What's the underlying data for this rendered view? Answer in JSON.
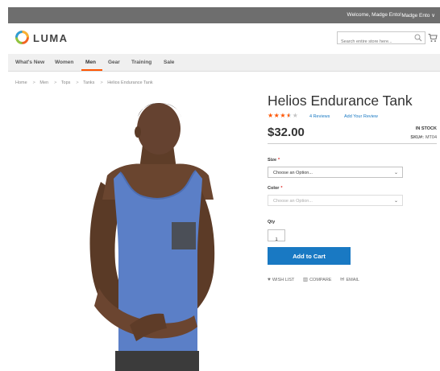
{
  "topbar": {
    "welcome": "Welcome, Madge Ento!",
    "account": "Madge Ento ∨"
  },
  "header": {
    "logo_text": "LUMA",
    "search_placeholder": "Search entire store here...",
    "icons": [
      "luma-logo-icon",
      "search-icon",
      "cart-icon"
    ]
  },
  "nav": {
    "items": [
      "What's New",
      "Women",
      "Men",
      "Gear",
      "Training",
      "Sale"
    ],
    "active": "Men",
    "accent": "#ff5501"
  },
  "breadcrumbs": [
    "Home",
    "Men",
    "Tops",
    "Tanks",
    "Helios Endurance Tank"
  ],
  "product": {
    "title": "Helios Endurance Tank",
    "rating_stars": 3.5,
    "rating_max": 5,
    "reviews": "4 Reviews",
    "add_review": "Add Your Review",
    "price": "$32.00",
    "stock": "IN STOCK",
    "sku_label": "SKU#:",
    "sku_value": "MT04"
  },
  "options": {
    "size_label": "Size",
    "size_value": "Choose an Option...",
    "color_label": "Color",
    "color_value": "Choose an Option...",
    "required_mark": "*"
  },
  "qty": {
    "label": "Qty",
    "value": "1"
  },
  "add_to_cart": "Add to Cart",
  "actions": {
    "wishlist": "WISH LIST",
    "compare": "COMPARE",
    "email": "EMAIL"
  },
  "colors": {
    "button_blue": "#1979c3",
    "link_blue": "#1979c3",
    "star_orange": "#ff5501",
    "topbar_gray": "#6e6e6e"
  }
}
